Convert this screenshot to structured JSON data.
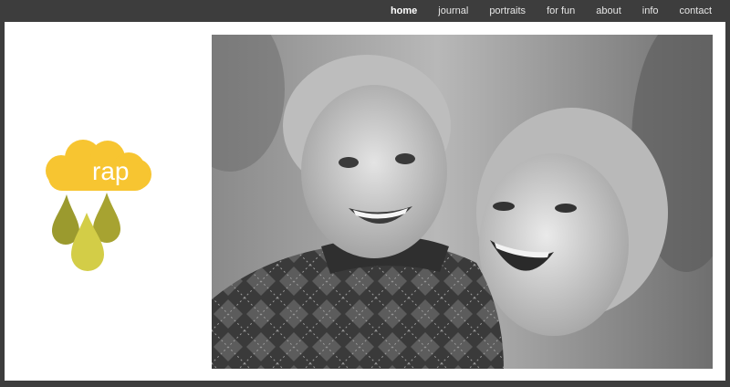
{
  "nav": {
    "items": [
      {
        "label": "home",
        "active": true
      },
      {
        "label": "journal",
        "active": false
      },
      {
        "label": "portraits",
        "active": false
      },
      {
        "label": "for fun",
        "active": false
      },
      {
        "label": "about",
        "active": false
      },
      {
        "label": "info",
        "active": false
      },
      {
        "label": "contact",
        "active": false
      }
    ]
  },
  "logo": {
    "text": "rap",
    "cloud_color": "#f7c531",
    "drop_colors": [
      "#9b9a2e",
      "#bcbb3c",
      "#d6d04a"
    ]
  },
  "photo": {
    "icon": "portrait-photo"
  }
}
